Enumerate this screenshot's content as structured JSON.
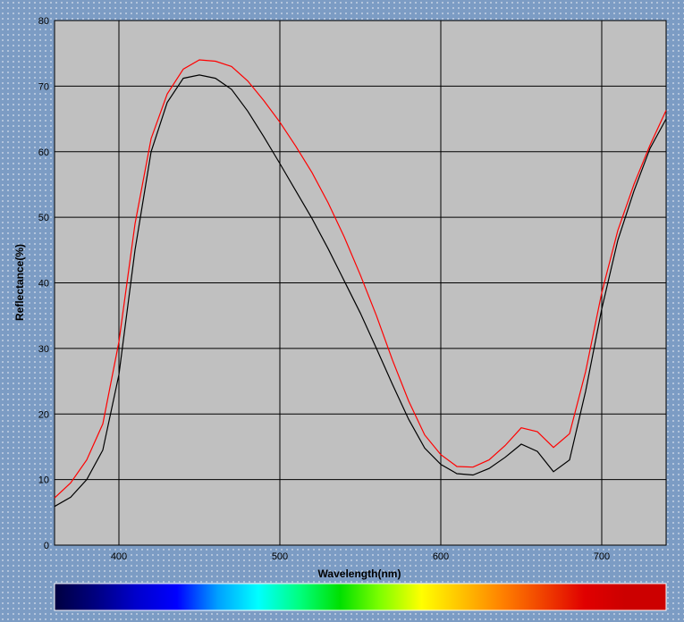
{
  "chart_data": {
    "type": "line",
    "xlabel": "Wavelength(nm)",
    "ylabel": "Reflectance(%)",
    "xlim": [
      360,
      740
    ],
    "ylim": [
      0,
      80
    ],
    "x_ticks": [
      400,
      500,
      600,
      700
    ],
    "y_ticks": [
      0,
      10,
      20,
      30,
      40,
      50,
      60,
      70,
      80
    ],
    "grid": true,
    "plot_background": "#c0c0c0",
    "series": [
      {
        "color": "#ff0000",
        "x": [
          360,
          370,
          380,
          390,
          400,
          410,
          420,
          430,
          440,
          450,
          460,
          470,
          480,
          490,
          500,
          510,
          520,
          530,
          540,
          550,
          560,
          570,
          580,
          590,
          600,
          610,
          620,
          630,
          640,
          650,
          660,
          670,
          680,
          690,
          700,
          710,
          720,
          730,
          740
        ],
        "values": [
          7.2,
          9.5,
          13.0,
          18.5,
          31.0,
          49.0,
          62.0,
          68.8,
          72.6,
          74.0,
          73.8,
          73.0,
          70.8,
          67.8,
          64.5,
          60.8,
          56.8,
          52.2,
          47.0,
          41.2,
          35.0,
          28.2,
          22.0,
          16.8,
          13.8,
          12.0,
          11.9,
          13.0,
          15.2,
          17.9,
          17.3,
          14.9,
          17.0,
          26.5,
          38.5,
          48.0,
          55.0,
          61.0,
          66.3
        ]
      },
      {
        "color": "#000000",
        "x": [
          360,
          370,
          380,
          390,
          400,
          410,
          420,
          430,
          440,
          450,
          460,
          470,
          480,
          490,
          500,
          510,
          520,
          530,
          540,
          550,
          560,
          570,
          580,
          590,
          600,
          610,
          620,
          630,
          640,
          650,
          660,
          670,
          680,
          690,
          700,
          710,
          720,
          730,
          740
        ],
        "values": [
          5.9,
          7.3,
          10.0,
          14.5,
          26.0,
          45.0,
          60.0,
          67.5,
          71.2,
          71.7,
          71.2,
          69.5,
          66.2,
          62.3,
          58.2,
          54.0,
          49.8,
          45.2,
          40.3,
          35.4,
          30.0,
          24.5,
          19.2,
          14.8,
          12.3,
          10.9,
          10.7,
          11.7,
          13.4,
          15.4,
          14.3,
          11.2,
          13.0,
          23.5,
          36.0,
          46.5,
          54.0,
          60.5,
          65.0
        ]
      }
    ]
  },
  "spectrum_bar": {
    "colors": [
      "#000040",
      "#000080",
      "#0000cc",
      "#0000ff",
      "#00a0ff",
      "#00ffff",
      "#00ff80",
      "#00e000",
      "#80ff00",
      "#ffff00",
      "#ffc000",
      "#ff8000",
      "#f04000",
      "#e00000",
      "#cc0000",
      "#cc0000"
    ]
  }
}
